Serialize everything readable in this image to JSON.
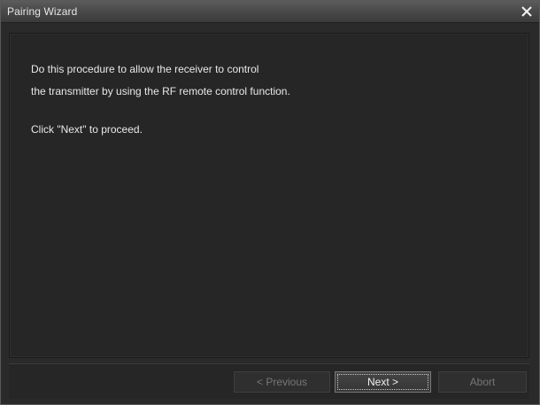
{
  "window": {
    "title": "Pairing Wizard"
  },
  "content": {
    "lines": [
      "Do this procedure to allow the receiver to control",
      "the transmitter by using the RF remote control function.",
      "",
      "Click \"Next\" to proceed."
    ]
  },
  "buttons": {
    "previous": "< Previous",
    "next": "Next >",
    "abort": "Abort"
  },
  "colors": {
    "background": "#2a2a2a",
    "text": "#e8e8e8",
    "disabled_text": "#777777"
  },
  "icons": {
    "close": "close-icon"
  }
}
